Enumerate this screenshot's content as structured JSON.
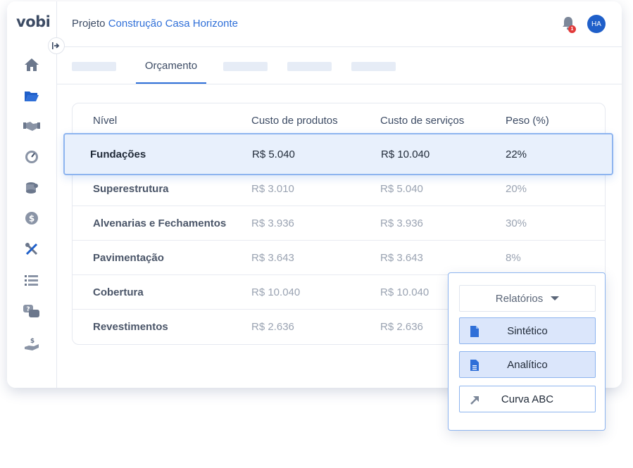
{
  "app": {
    "logo": "vobi"
  },
  "header": {
    "breadcrumb_prefix": "Projeto",
    "project_name": "Construção Casa Horizonte",
    "notification_count": "1",
    "avatar_initials": "HA"
  },
  "sidebar": {
    "icons": [
      "home-icon",
      "folder-icon",
      "handshake-icon",
      "gauge-icon",
      "coins-icon",
      "dollar-icon",
      "tools-icon",
      "list-icon",
      "chat-icon",
      "hand-money-icon"
    ]
  },
  "tabs": {
    "active_label": "Orçamento"
  },
  "table": {
    "headers": [
      "Nível",
      "Custo de produtos",
      "Custo de serviços",
      "Peso (%)"
    ],
    "rows": [
      [
        "Fundações",
        "R$ 5.040",
        "R$ 10.040",
        "22%"
      ],
      [
        "Superestrutura",
        "R$ 3.010",
        "R$ 5.040",
        "20%"
      ],
      [
        "Alvenarias e Fechamentos",
        "R$ 3.936",
        "R$ 3.936",
        "30%"
      ],
      [
        "Pavimentação",
        "R$ 3.643",
        "R$ 3.643",
        "8%"
      ],
      [
        "Cobertura",
        "R$ 10.040",
        "R$ 10.040",
        ""
      ],
      [
        "Revestimentos",
        "R$ 2.636",
        "R$ 2.636",
        ""
      ]
    ]
  },
  "reports": {
    "dropdown_label": "Relatórios",
    "options": [
      "Sintético",
      "Analítico",
      "Curva ABC"
    ]
  },
  "colors": {
    "accent": "#2f6fd8",
    "highlight_bg": "#e8f0fc",
    "highlight_border": "#8db4ef",
    "badge": "#e23a3a"
  }
}
